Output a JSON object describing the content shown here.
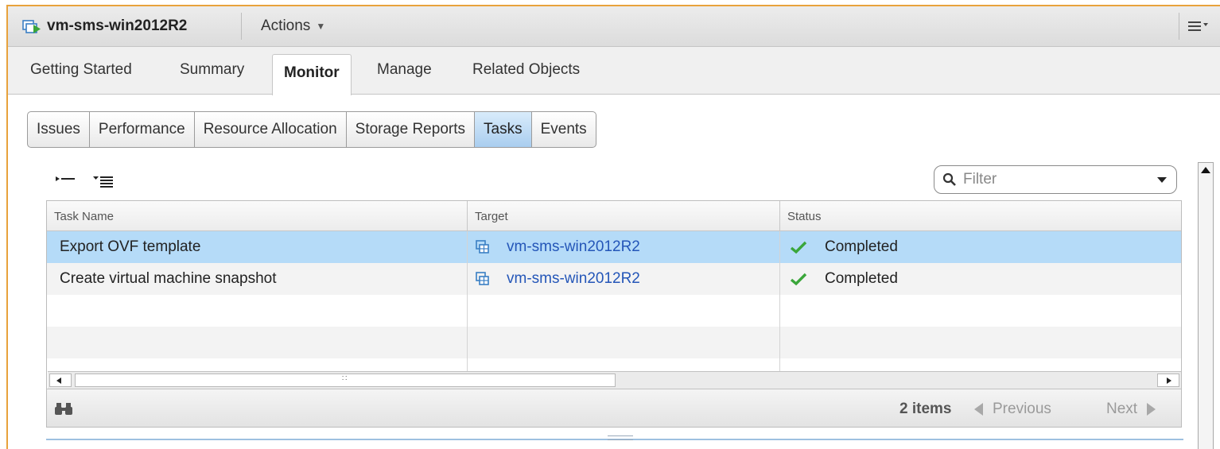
{
  "header": {
    "vm_name": "vm-sms-win2012R2",
    "actions_label": "Actions",
    "vm_icon": "vm-powered-on-icon",
    "menu_icon": "panel-menu-icon"
  },
  "main_tabs": [
    {
      "label": "Getting Started",
      "active": false
    },
    {
      "label": "Summary",
      "active": false
    },
    {
      "label": "Monitor",
      "active": true
    },
    {
      "label": "Manage",
      "active": false
    },
    {
      "label": "Related Objects",
      "active": false
    }
  ],
  "sub_tabs": [
    {
      "label": "Issues",
      "active": false
    },
    {
      "label": "Performance",
      "active": false
    },
    {
      "label": "Resource Allocation",
      "active": false
    },
    {
      "label": "Storage Reports",
      "active": false
    },
    {
      "label": "Tasks",
      "active": true
    },
    {
      "label": "Events",
      "active": false
    }
  ],
  "toolbar": {
    "filter_placeholder": "Filter"
  },
  "grid": {
    "columns": [
      "Task Name",
      "Target",
      "Status"
    ],
    "rows": [
      {
        "task": "Export OVF template",
        "target": "vm-sms-win2012R2",
        "status": "Completed",
        "selected": true
      },
      {
        "task": "Create virtual machine snapshot",
        "target": "vm-sms-win2012R2",
        "status": "Completed",
        "selected": false
      }
    ]
  },
  "footer": {
    "items_count": "2 items",
    "previous_label": "Previous",
    "next_label": "Next"
  },
  "colors": {
    "selected_row": "#b5dbf8",
    "link": "#2456b8",
    "status_ok": "#3aa63a",
    "accent_border": "#e8a23c"
  }
}
